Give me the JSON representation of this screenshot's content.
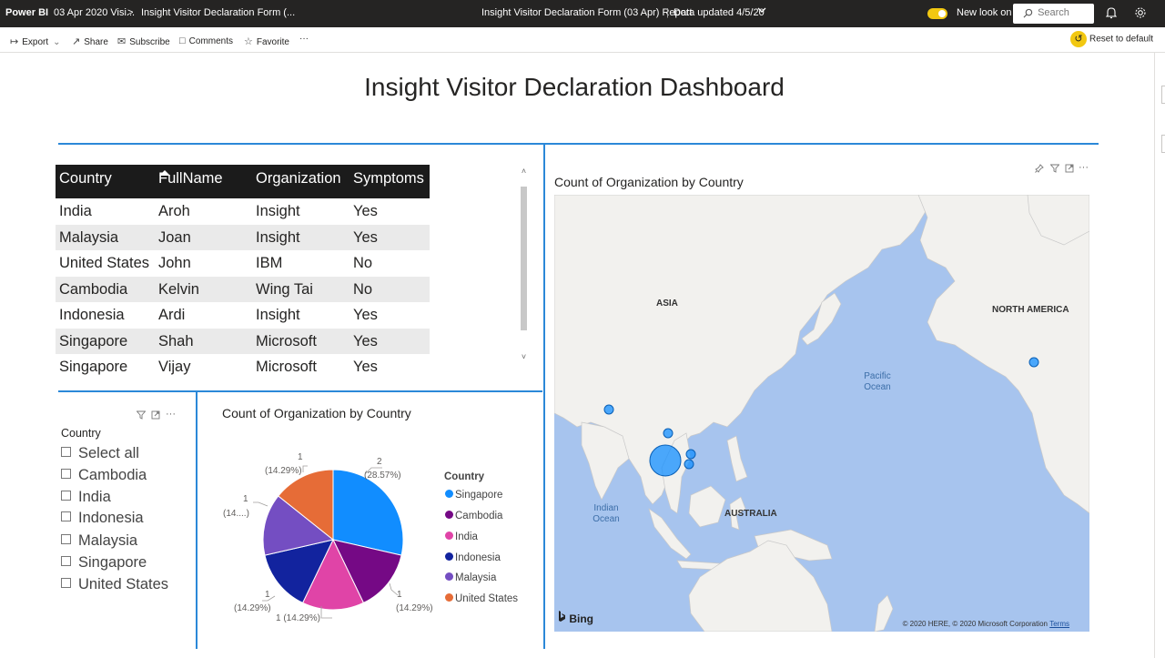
{
  "topbar": {
    "brand": "Power BI",
    "breadcrumb_1": "03 Apr 2020 Visi...",
    "breadcrumb_2": "Insight Visitor Declaration Form (...",
    "report_title": "Insight Visitor Declaration Form (03 Apr) Report",
    "separator": "|",
    "data_updated": "Data updated 4/5/20",
    "new_look_label": "New look on",
    "search_placeholder": "Search"
  },
  "actions": {
    "export": "Export",
    "share": "Share",
    "subscribe": "Subscribe",
    "comments": "Comments",
    "favorite": "Favorite",
    "more": "···",
    "reset": "Reset to default"
  },
  "dashboard_title": "Insight Visitor Declaration Dashboard",
  "table": {
    "headers": [
      "Country",
      "FullName",
      "Organization",
      "Symptoms"
    ],
    "rows": [
      [
        "India",
        "Aroh",
        "Insight",
        "Yes"
      ],
      [
        "Malaysia",
        "Joan",
        "Insight",
        "Yes"
      ],
      [
        "United States",
        "John",
        "IBM",
        "No"
      ],
      [
        "Cambodia",
        "Kelvin",
        "Wing Tai",
        "No"
      ],
      [
        "Indonesia",
        "Ardi",
        "Insight",
        "Yes"
      ],
      [
        "Singapore",
        "Shah",
        "Microsoft",
        "Yes"
      ],
      [
        "Singapore",
        "Vijay",
        "Microsoft",
        "Yes"
      ]
    ]
  },
  "slicer": {
    "title": "Country",
    "items": [
      "Select all",
      "Cambodia",
      "India",
      "Indonesia",
      "Malaysia",
      "Singapore",
      "United States"
    ]
  },
  "pie": {
    "title": "Count of Organization by Country",
    "legend_title": "Country",
    "labels": {
      "singapore_count": "2",
      "singapore_pct": "(28.57%)",
      "cambodia_count": "1",
      "cambodia_pct": "(14.29%)",
      "india_label": "1 (14.29%)",
      "indonesia_count": "1",
      "indonesia_pct": "(14.29%)",
      "malaysia_count": "1",
      "malaysia_pct": "(14....)",
      "unitedstates_count": "1",
      "unitedstates_pct": "(14.29%)"
    }
  },
  "chart_data": {
    "type": "pie",
    "title": "Count of Organization by Country",
    "categories": [
      "Singapore",
      "Cambodia",
      "India",
      "Indonesia",
      "Malaysia",
      "United States"
    ],
    "values": [
      2,
      1,
      1,
      1,
      1,
      1
    ],
    "percentages": [
      28.57,
      14.29,
      14.29,
      14.29,
      14.29,
      14.29
    ],
    "colors": [
      "#118dff",
      "#750985",
      "#e044a7",
      "#12239e",
      "#744ec2",
      "#e66c37"
    ],
    "legend_position": "right"
  },
  "map": {
    "title": "Count of Organization by Country",
    "labels": {
      "asia": "ASIA",
      "north_america": "NORTH AMERICA",
      "australia": "AUSTRALIA",
      "pacific_ocean": "Pacific Ocean",
      "indian_ocean": "Indian Ocean"
    },
    "provider": "Bing",
    "attribution": "© 2020 HERE, © 2020 Microsoft Corporation",
    "terms": "Terms",
    "bubbles": [
      {
        "country": "India",
        "count": 1
      },
      {
        "country": "Cambodia",
        "count": 1
      },
      {
        "country": "Singapore",
        "count": 2
      },
      {
        "country": "Malaysia",
        "count": 1
      },
      {
        "country": "Indonesia",
        "count": 1
      },
      {
        "country": "United States",
        "count": 1
      }
    ],
    "bubble_color": "#118dff"
  },
  "icons": {
    "pin": "pin-icon",
    "filter": "filter-icon",
    "focus": "focus-mode-icon",
    "more": "more-options-icon"
  }
}
